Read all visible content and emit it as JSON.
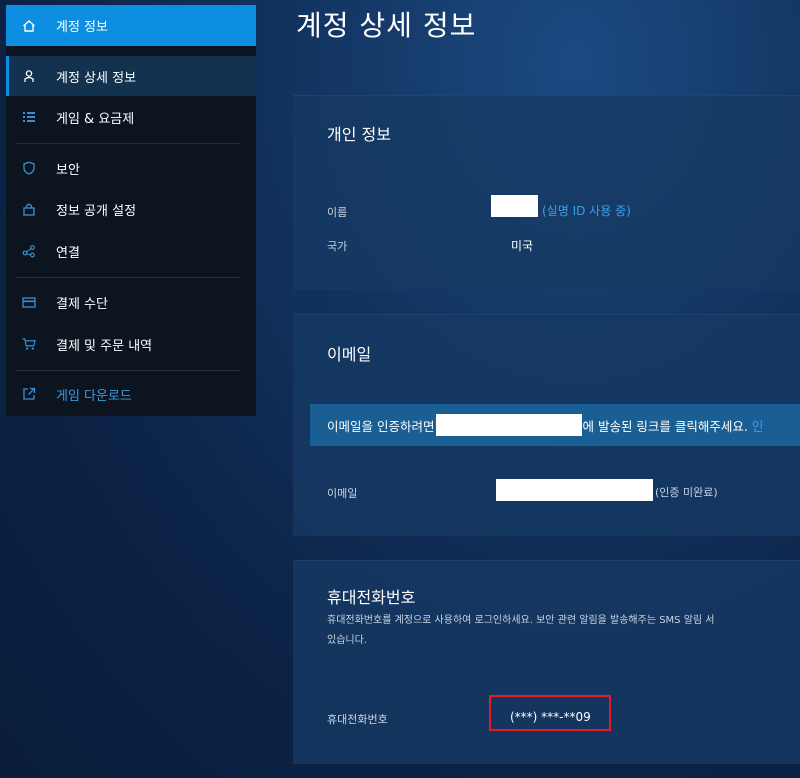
{
  "sidebar": {
    "header": {
      "label": "계정 정보",
      "icon": "home-icon"
    },
    "items": [
      {
        "label": "계정 상세 정보",
        "icon": "user-icon",
        "active": true
      },
      {
        "label": "게임 & 요금제",
        "icon": "list-icon"
      },
      {
        "label": "보안",
        "icon": "shield-icon"
      },
      {
        "label": "정보 공개 설정",
        "icon": "lock-icon"
      },
      {
        "label": "연결",
        "icon": "share-icon"
      },
      {
        "label": "결제 수단",
        "icon": "credit-card-icon"
      },
      {
        "label": "결제 및 주문 내역",
        "icon": "cart-icon"
      },
      {
        "label": "게임 다운로드",
        "icon": "external-link-icon"
      }
    ]
  },
  "page_title": "계정 상세 정보",
  "personal": {
    "title": "개인 정보",
    "name_label": "이름",
    "name_note": "(실명 ID 사용 중)",
    "country_label": "국가",
    "country_value": "미국"
  },
  "email": {
    "title": "이메일",
    "notice_prefix": "이메일을 인증하려면",
    "notice_suffix": "에 발송된 링크를 클릭해주세요.",
    "notice_link": "인",
    "label": "이메일",
    "status": "(인증 미완료)"
  },
  "phone": {
    "title": "휴대전화번호",
    "desc_line1": "휴대전화번호를 계정으로 사용하여 로그인하세요. 보안 관련 알림을 발송해주는 SMS 알림 서",
    "desc_line2": "있습니다.",
    "label": "휴대전화번호",
    "value": "(***) ***-**09"
  },
  "colors": {
    "accent": "#0d8ee0",
    "link": "#3aa0e8",
    "highlight": "#e31c25"
  }
}
